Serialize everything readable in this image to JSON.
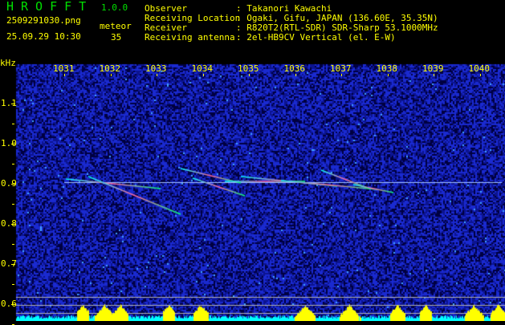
{
  "app": {
    "title": "HROFFT",
    "version": "1.0.0"
  },
  "file": {
    "name": "2509291030.png",
    "datetime": "25.09.29 10:30"
  },
  "meteor": {
    "label": "meteor",
    "count": "35"
  },
  "info": [
    {
      "label": "Observer",
      "value": ": Takanori Kawachi"
    },
    {
      "label": "Receiving Location",
      "value": ": Ogaki, Gifu, JAPAN (136.60E, 35.35N)"
    },
    {
      "label": "Receiver",
      "value": ": R820T2(RTL-SDR) SDR-Sharp 53.1000MHz"
    },
    {
      "label": "Receiving antenna",
      "value": ": 2el-HB9CV Vertical (el. E-W)"
    }
  ],
  "axis": {
    "unit": "kHz",
    "x_ticks": [
      "1031",
      "1032",
      "1033",
      "1034",
      "1035",
      "1036",
      "1037",
      "1038",
      "1039",
      "1040"
    ],
    "y_ticks": [
      "1.1",
      "1.0",
      "0.9",
      "0.8",
      "0.7",
      "0.6"
    ]
  },
  "colors": {
    "text": "#ffff00",
    "title": "#00e000",
    "noise": "#1020c0",
    "histogram_low": "#00ffff",
    "histogram_high": "#ffff00"
  }
}
